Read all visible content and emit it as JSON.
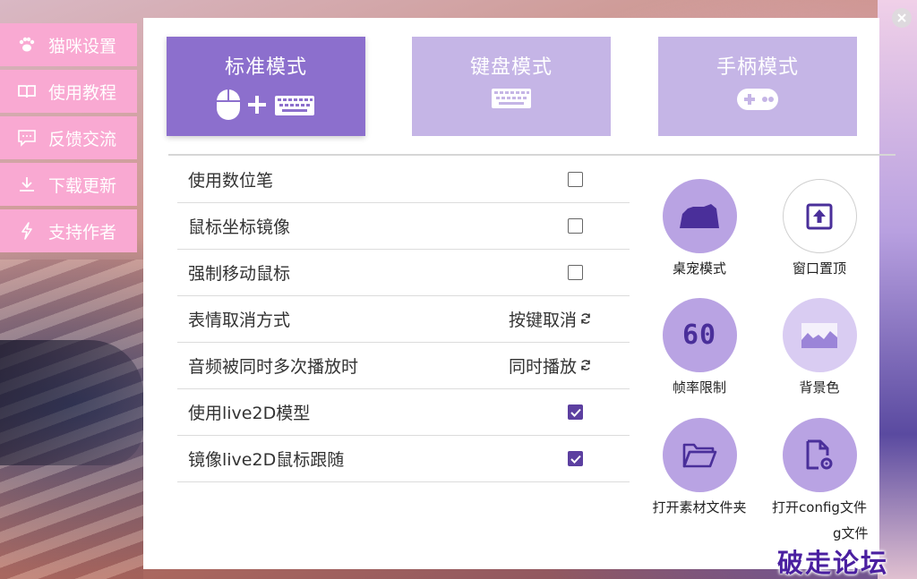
{
  "sidebar": {
    "items": [
      {
        "label": "猫咪设置",
        "icon": "paw-icon"
      },
      {
        "label": "使用教程",
        "icon": "book-icon"
      },
      {
        "label": "反馈交流",
        "icon": "chat-icon"
      },
      {
        "label": "下载更新",
        "icon": "download-icon"
      },
      {
        "label": "支持作者",
        "icon": "bolt-icon"
      }
    ]
  },
  "modes": [
    {
      "label": "标准模式",
      "icon": "mouse-plus-keyboard-icon",
      "active": true
    },
    {
      "label": "键盘模式",
      "icon": "keyboard-icon",
      "active": false
    },
    {
      "label": "手柄模式",
      "icon": "gamepad-icon",
      "active": false
    }
  ],
  "settings": [
    {
      "label": "使用数位笔",
      "type": "checkbox",
      "checked": false
    },
    {
      "label": "鼠标坐标镜像",
      "type": "checkbox",
      "checked": false
    },
    {
      "label": "强制移动鼠标",
      "type": "checkbox",
      "checked": false
    },
    {
      "label": "表情取消方式",
      "type": "cycle",
      "value": "按键取消"
    },
    {
      "label": "音频被同时多次播放时",
      "type": "cycle",
      "value": "同时播放"
    },
    {
      "label": "使用live2D模型",
      "type": "checkbox",
      "checked": true
    },
    {
      "label": "镜像live2D鼠标跟随",
      "type": "checkbox",
      "checked": true
    }
  ],
  "tools": [
    {
      "label": "桌宠模式",
      "icon": "cat-silhouette-icon"
    },
    {
      "label": "窗口置顶",
      "icon": "pin-top-icon"
    },
    {
      "label": "帧率限制",
      "icon": "fps-60-icon",
      "icon_text": "60"
    },
    {
      "label": "背景色",
      "icon": "landscape-icon"
    },
    {
      "label": "打开素材文件夹",
      "icon": "folder-open-icon"
    },
    {
      "label": "打开config文件",
      "icon": "file-settings-icon"
    }
  ],
  "overflow_label": "g文件",
  "watermark": "破走论坛",
  "colors": {
    "sidebar_pink": "#f9a9d2",
    "mode_active": "#8c6fcd",
    "mode_inactive": "#c5b5e6",
    "check_purple": "#5c3fa0",
    "icon_purple": "#4a2f9a"
  }
}
